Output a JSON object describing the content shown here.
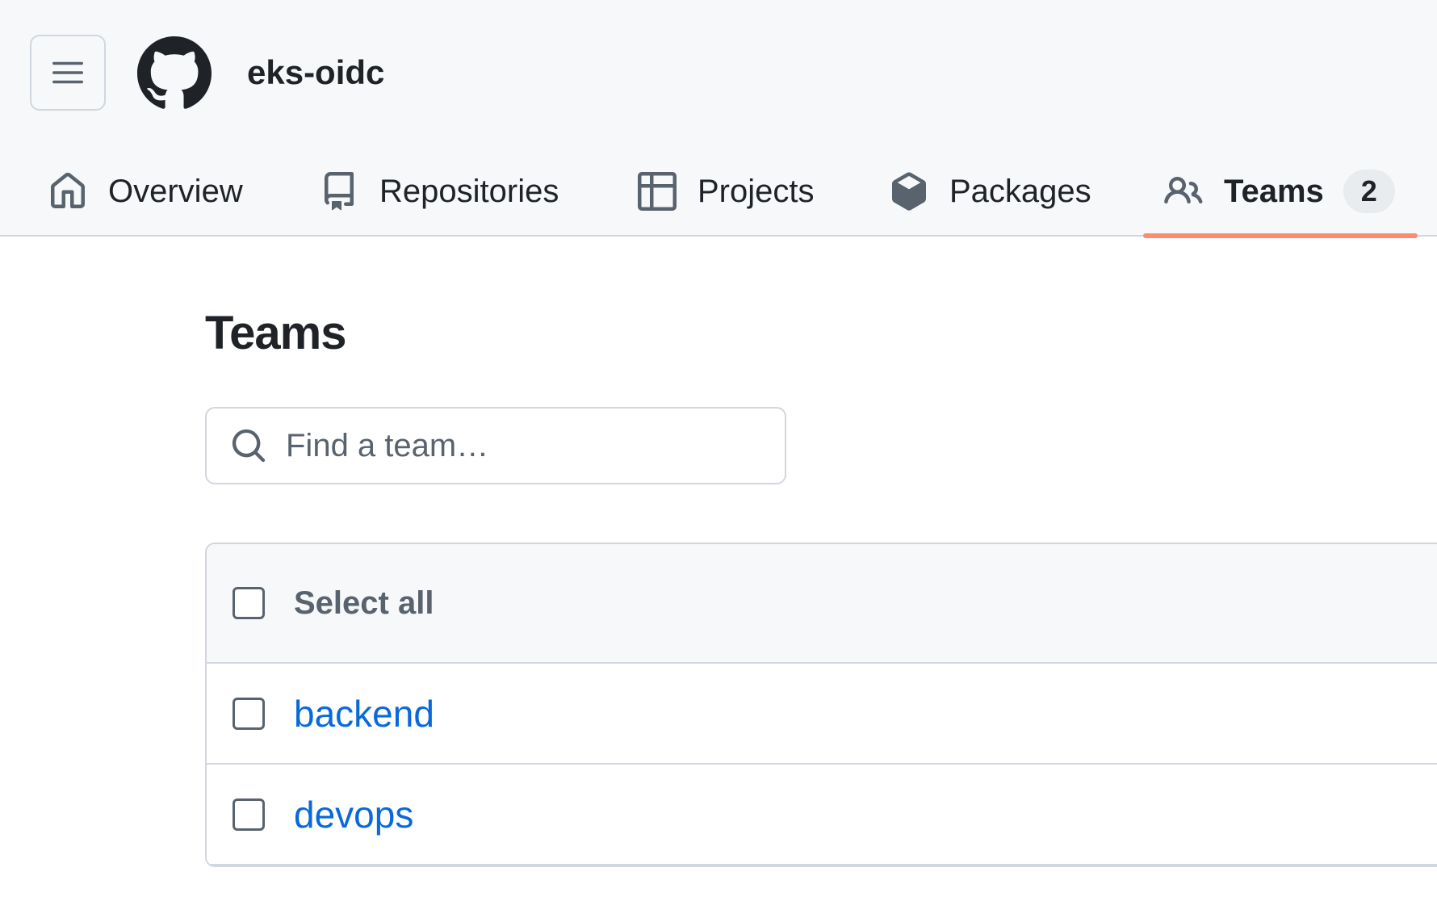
{
  "header": {
    "org_name": "eks-oidc",
    "menu_icon": "hamburger-icon",
    "logo_icon": "github-mark-icon"
  },
  "tabs": [
    {
      "label": "Overview",
      "icon": "home-icon",
      "selected": false
    },
    {
      "label": "Repositories",
      "icon": "repo-icon",
      "selected": false
    },
    {
      "label": "Projects",
      "icon": "table-icon",
      "selected": false
    },
    {
      "label": "Packages",
      "icon": "package-icon",
      "selected": false
    },
    {
      "label": "Teams",
      "icon": "people-icon",
      "selected": true,
      "count": "2"
    }
  ],
  "main": {
    "title": "Teams",
    "search": {
      "placeholder": "Find a team…",
      "value": ""
    },
    "list": {
      "select_all_label": "Select all",
      "teams": [
        {
          "name": "backend"
        },
        {
          "name": "devops"
        }
      ]
    }
  },
  "colors": {
    "accent_underline": "#fd8c73",
    "link": "#0969da",
    "header_bg": "#f6f8fa",
    "border": "#d0d7de"
  }
}
